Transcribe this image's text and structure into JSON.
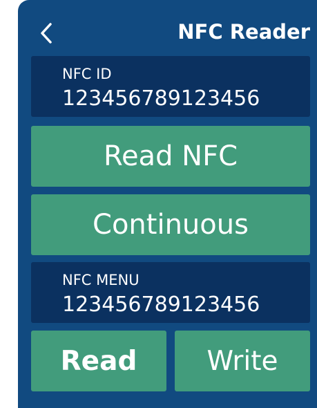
{
  "header": {
    "title": "NFC Reader",
    "back_icon": "chevron-left-icon"
  },
  "nfc_id": {
    "label": "NFC ID",
    "value": "123456789123456"
  },
  "buttons": {
    "read_nfc": "Read NFC",
    "continuous": "Continuous",
    "read": "Read",
    "write": "Write"
  },
  "nfc_menu": {
    "label": "NFC MENU",
    "value": "123456789123456"
  },
  "colors": {
    "background": "#114a80",
    "panel": "#0b3160",
    "button": "#429c7c",
    "text": "#ffffff"
  }
}
